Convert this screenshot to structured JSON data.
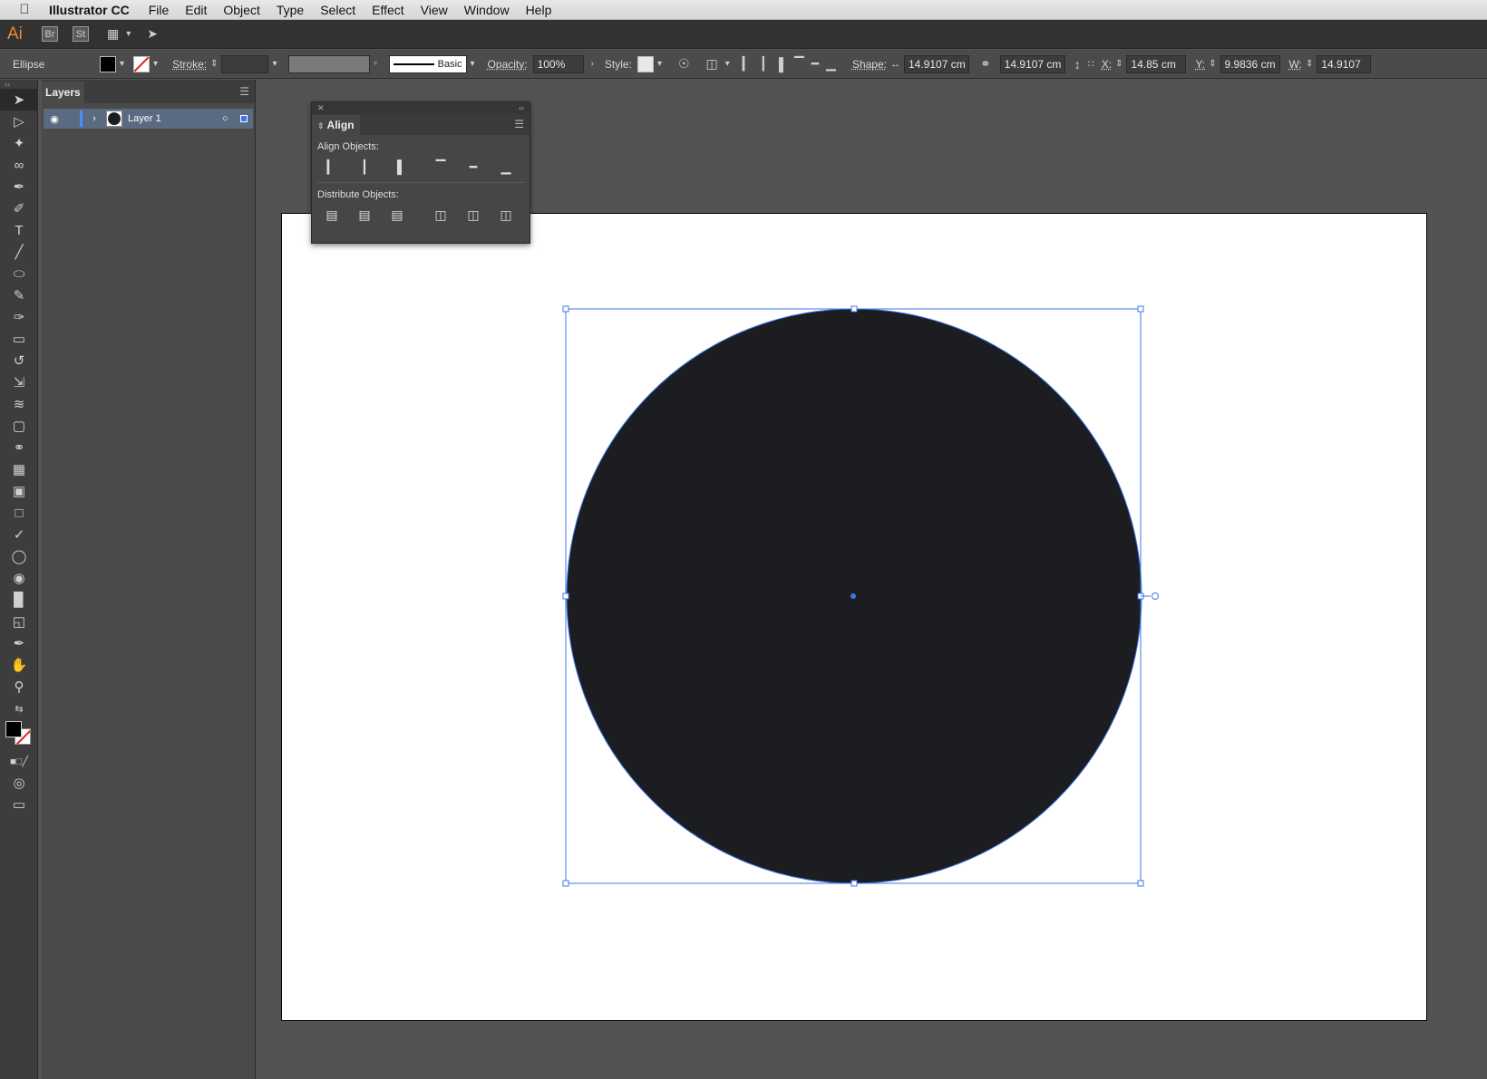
{
  "menubar": {
    "app_name": "Illustrator CC",
    "items": [
      "File",
      "Edit",
      "Object",
      "Type",
      "Select",
      "Effect",
      "View",
      "Window",
      "Help"
    ]
  },
  "appbar": {
    "logo": "Ai",
    "bridge": "Br",
    "stock": "St"
  },
  "control": {
    "object_type": "Ellipse",
    "stroke_label": "Stroke:",
    "brush_label": "Basic",
    "opacity_label": "Opacity:",
    "opacity_value": "100%",
    "style_label": "Style:",
    "shape_label": "Shape:",
    "shape_width": "14.9107 cm",
    "shape_height": "14.9107 cm",
    "x_label": "X:",
    "x_value": "14.85 cm",
    "y_label": "Y:",
    "y_value": "9.9836 cm",
    "w_label": "W:",
    "w_value": "14.9107"
  },
  "layers": {
    "tab": "Layers",
    "items": [
      {
        "name": "Layer 1"
      }
    ]
  },
  "align_panel": {
    "tab": "Align",
    "align_objects_label": "Align Objects:",
    "distribute_objects_label": "Distribute Objects:"
  },
  "colors": {
    "selection": "#3b78e7",
    "ellipse_fill": "#1c1d21",
    "layer_highlight": "#5a6a80"
  }
}
